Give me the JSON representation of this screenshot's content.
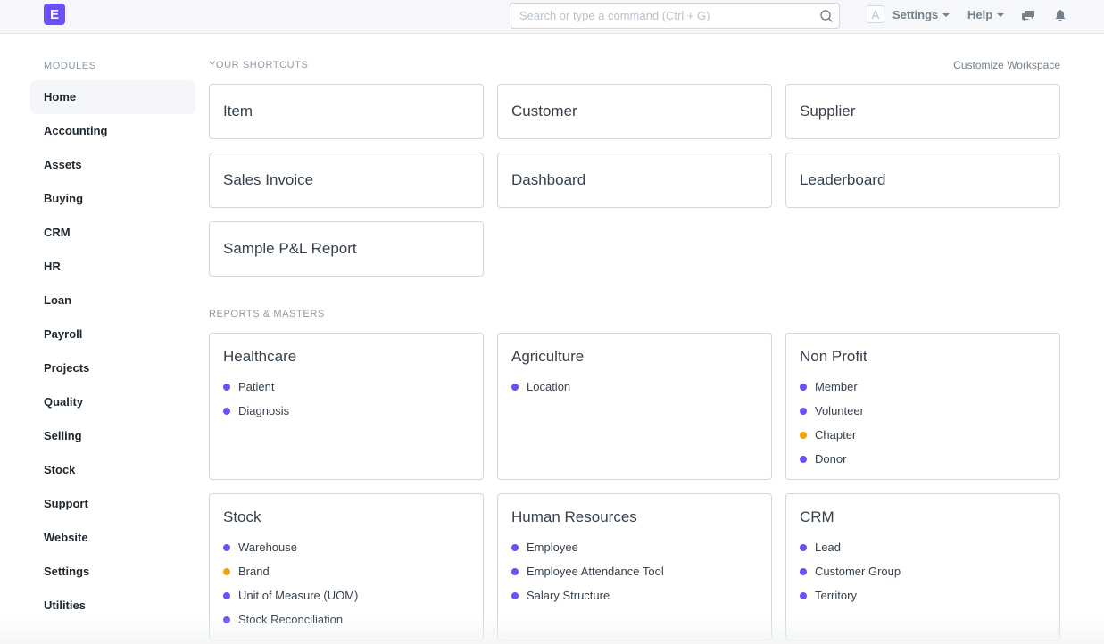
{
  "navbar": {
    "logo_letter": "E",
    "search_placeholder": "Search or type a command (Ctrl + G)",
    "avatar_letter": "A",
    "settings_label": "Settings",
    "help_label": "Help"
  },
  "sidebar": {
    "title": "MODULES",
    "items": [
      {
        "label": "Home",
        "active": true
      },
      {
        "label": "Accounting"
      },
      {
        "label": "Assets"
      },
      {
        "label": "Buying"
      },
      {
        "label": "CRM"
      },
      {
        "label": "HR"
      },
      {
        "label": "Loan"
      },
      {
        "label": "Payroll"
      },
      {
        "label": "Projects"
      },
      {
        "label": "Quality"
      },
      {
        "label": "Selling"
      },
      {
        "label": "Stock"
      },
      {
        "label": "Support"
      },
      {
        "label": "Website"
      },
      {
        "label": "Settings"
      },
      {
        "label": "Utilities"
      }
    ]
  },
  "shortcuts": {
    "title": "YOUR SHORTCUTS",
    "customize_label": "Customize Workspace",
    "items": [
      "Item",
      "Customer",
      "Supplier",
      "Sales Invoice",
      "Dashboard",
      "Leaderboard",
      "Sample P&L Report"
    ]
  },
  "colors": {
    "accent": "#6b4ff7",
    "link_dot_default": "#6b4ff7",
    "link_dot_warning": "#f5a10c"
  },
  "reports": {
    "title": "REPORTS & MASTERS",
    "cards": [
      {
        "title": "Healthcare",
        "links": [
          {
            "label": "Patient",
            "status": "default"
          },
          {
            "label": "Diagnosis",
            "status": "default"
          }
        ]
      },
      {
        "title": "Agriculture",
        "links": [
          {
            "label": "Location",
            "status": "default"
          }
        ]
      },
      {
        "title": "Non Profit",
        "links": [
          {
            "label": "Member",
            "status": "default"
          },
          {
            "label": "Volunteer",
            "status": "default"
          },
          {
            "label": "Chapter",
            "status": "warning"
          },
          {
            "label": "Donor",
            "status": "default"
          }
        ]
      },
      {
        "title": "Stock",
        "links": [
          {
            "label": "Warehouse",
            "status": "default"
          },
          {
            "label": "Brand",
            "status": "warning"
          },
          {
            "label": "Unit of Measure (UOM)",
            "status": "default"
          },
          {
            "label": "Stock Reconciliation",
            "status": "default"
          }
        ]
      },
      {
        "title": "Human Resources",
        "links": [
          {
            "label": "Employee",
            "status": "default"
          },
          {
            "label": "Employee Attendance Tool",
            "status": "default"
          },
          {
            "label": "Salary Structure",
            "status": "default"
          }
        ]
      },
      {
        "title": "CRM",
        "links": [
          {
            "label": "Lead",
            "status": "default"
          },
          {
            "label": "Customer Group",
            "status": "default"
          },
          {
            "label": "Territory",
            "status": "default"
          }
        ]
      }
    ]
  }
}
